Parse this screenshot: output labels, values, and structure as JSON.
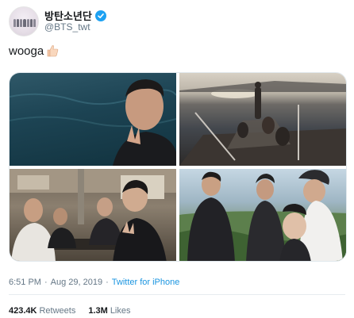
{
  "user": {
    "display_name": "방탄소년단",
    "handle": "@BTS_twt",
    "verified_icon": "verified-badge-icon",
    "avatar_icon": "group-avatar-icon"
  },
  "tweet": {
    "text": "wooga",
    "emoji_icon": "thumbs-up-emoji-icon"
  },
  "media": {
    "photos": [
      {
        "name": "photo-sea-selfie"
      },
      {
        "name": "photo-boat-sunset"
      },
      {
        "name": "photo-restaurant-group"
      },
      {
        "name": "photo-coast-group-selfie"
      }
    ]
  },
  "meta": {
    "time": "6:51 PM",
    "separator": "·",
    "date": "Aug 29, 2019",
    "separator2": "·",
    "source": "Twitter for iPhone"
  },
  "stats": {
    "retweets_count": "423.4K",
    "retweets_label": "Retweets",
    "likes_count": "1.3M",
    "likes_label": "Likes"
  },
  "colors": {
    "link": "#1b95e0",
    "verified": "#1da1f2",
    "secondary_text": "#657786"
  }
}
